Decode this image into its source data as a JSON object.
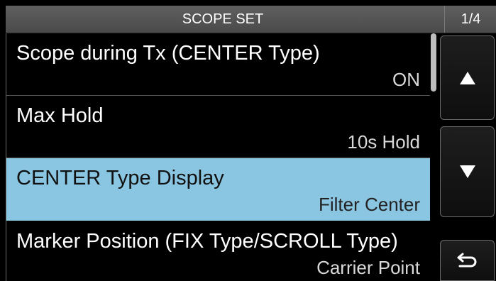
{
  "header": {
    "title": "SCOPE SET",
    "page": "1/4"
  },
  "menu": {
    "items": [
      {
        "label": "Scope during Tx (CENTER Type)",
        "value": "ON",
        "selected": false
      },
      {
        "label": "Max Hold",
        "value": "10s Hold",
        "selected": false
      },
      {
        "label": "CENTER Type Display",
        "value": "Filter Center",
        "selected": true
      },
      {
        "label": "Marker Position (FIX Type/SCROLL Type)",
        "value": "Carrier Point",
        "selected": false
      }
    ]
  },
  "controls": {
    "up_icon": "triangle-up-icon",
    "down_icon": "triangle-down-icon",
    "back_icon": "return-arrow-icon"
  },
  "colors": {
    "selected_background": "#8ac6e1",
    "title_background": "#5a5a5a",
    "screen_background": "#000000"
  }
}
